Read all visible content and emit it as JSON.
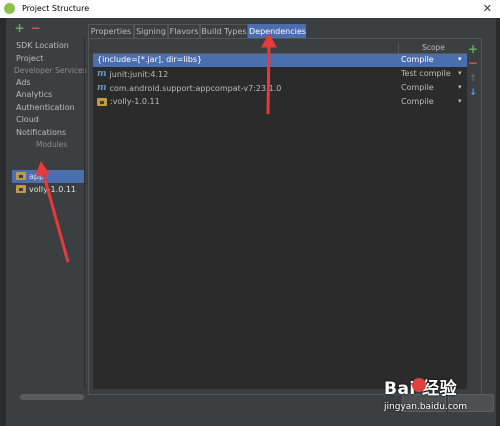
{
  "window": {
    "title": "Project Structure",
    "close": "✕"
  },
  "left_toolbar": {
    "add": "+",
    "remove": "−"
  },
  "left_nav": {
    "items": [
      "SDK Location",
      "Project"
    ],
    "section_developer": "Developer Services",
    "dev_items": [
      "Ads",
      "Analytics",
      "Authentication",
      "Cloud",
      "Notifications"
    ],
    "section_modules": "Modules",
    "modules": [
      "app",
      "volly-1.0.11"
    ]
  },
  "tabs": [
    "Properties",
    "Signing",
    "Flavors",
    "Build Types",
    "Dependencies"
  ],
  "active_tab": "Dependencies",
  "table": {
    "header_scope": "Scope",
    "rows": [
      {
        "name": "{include=[*.jar], dir=libs}",
        "scope": "Compile",
        "icon": "none",
        "selected": true
      },
      {
        "name": "junit:junit:4.12",
        "scope": "Test compile",
        "icon": "maven-icon",
        "selected": false
      },
      {
        "name": "com.android.support:appcompat-v7:23.1.0",
        "scope": "Compile",
        "icon": "maven-icon",
        "selected": false
      },
      {
        "name": ":volly-1.0.11",
        "scope": "Compile",
        "icon": "module-folder-icon",
        "selected": false
      }
    ]
  },
  "right_toolbar": {
    "add": "+",
    "remove": "−",
    "up": "↑",
    "down": "↓"
  },
  "watermark": {
    "logo": "Bai  经验",
    "url": "jingyan.baidu.com"
  },
  "colors": {
    "selection": "#4b6eaf",
    "annotation_arrow": "#e83a3a",
    "background": "#3c3f41"
  }
}
